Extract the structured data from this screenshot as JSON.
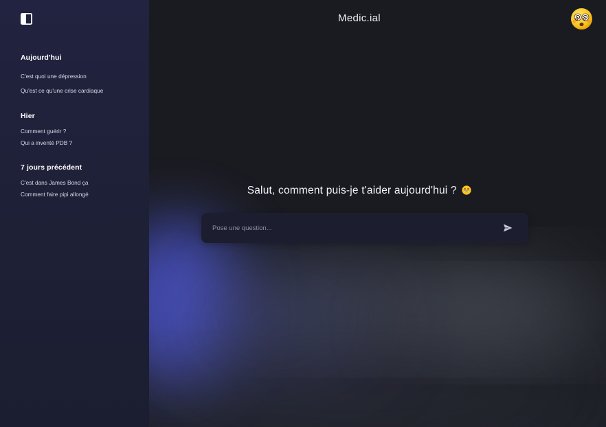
{
  "app": {
    "title": "Medic.ial"
  },
  "sidebar": {
    "toggle_icon": "sidebar-panel-icon",
    "sections": [
      {
        "heading": "Aujourd'hui",
        "items": [
          {
            "label": "C'est quoi une dépression"
          },
          {
            "label": "Qu'est ce qu'une crise cardiaque"
          }
        ]
      },
      {
        "heading": "Hier",
        "items": [
          {
            "label": "Comment guérir ?"
          },
          {
            "label": "Qui a inventé PDB ?"
          }
        ]
      },
      {
        "heading": "7 jours précédent",
        "items": [
          {
            "label": "C'est dans James Bond ça"
          },
          {
            "label": "Comment faire pipi allongé"
          }
        ]
      }
    ]
  },
  "header": {
    "avatar_icon": "dizzy-face-emoji-avatar"
  },
  "main": {
    "greeting": "Salut, comment puis-je t'aider aujourd'hui ?",
    "greeting_emoji": "grinning-face-emoji"
  },
  "composer": {
    "placeholder": "Pose une question...",
    "value": "",
    "send_icon": "send-arrow-icon"
  },
  "colors": {
    "sidebar_bg": "#1f2138",
    "main_bg": "#1a1b20",
    "composer_bg": "#1c1e30",
    "glow_blue": "#4a52c8",
    "text_primary": "#ffffff"
  }
}
